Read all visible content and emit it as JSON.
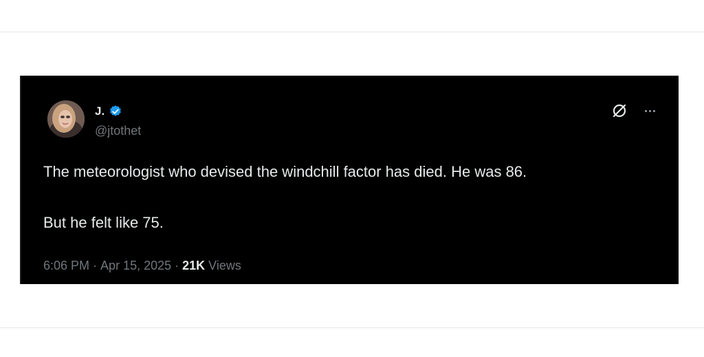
{
  "tweet": {
    "author_name": "J.",
    "handle": "@jtothet",
    "text_line1": "The meteorologist who devised the windchill factor has died. He was 86.",
    "text_line2": "But he felt like 75.",
    "time": "6:06 PM",
    "separator": " · ",
    "date": "Apr 15, 2025",
    "views_count": "21K",
    "views_label": " Views"
  },
  "icons": {
    "verified": "verified-badge-icon",
    "grok": "grok-icon",
    "more": "more-options-icon"
  },
  "colors": {
    "card_background": "#000000",
    "text_primary": "#e7e9ea",
    "text_secondary": "#71767b",
    "verified_blue": "#1d9bf0"
  }
}
